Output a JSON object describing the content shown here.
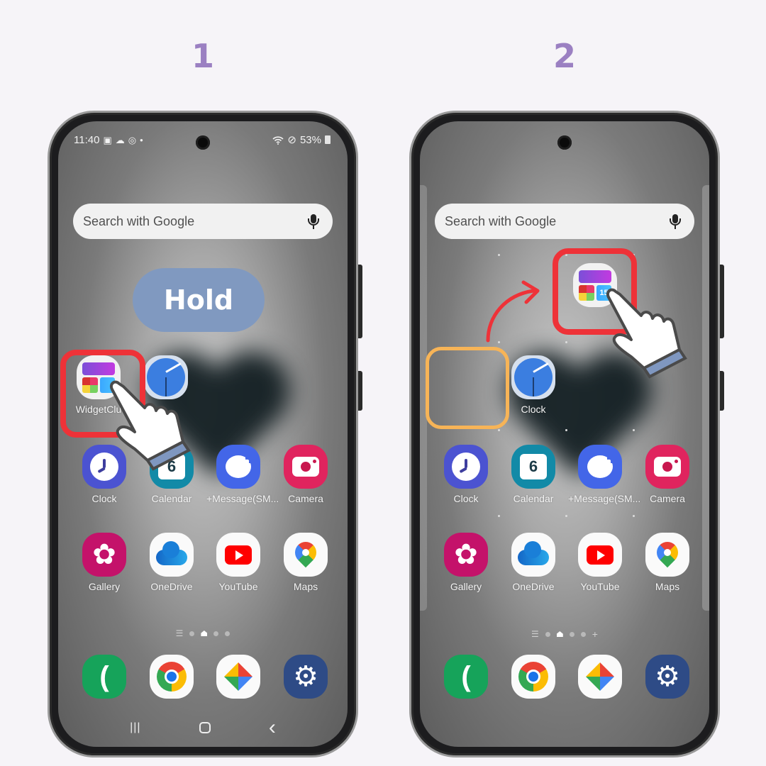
{
  "steps": [
    {
      "number": "1",
      "statusbar": {
        "time": "11:40",
        "left_icons": [
          "gallery-notification-icon",
          "weather-icon",
          "sync-icon",
          "dot-icon"
        ],
        "right_icons": [
          "wifi-icon",
          "do-not-disturb-icon"
        ],
        "battery": "53%"
      },
      "search": {
        "placeholder": "Search with Google",
        "mic_icon": "mic-icon"
      },
      "hint": "Hold",
      "highlighted_app": {
        "label": "WidgetClub",
        "visible_label": "WidgetClu"
      },
      "row1": [
        {
          "label": "WidgetClub",
          "icon": "widgetclub-icon"
        },
        {
          "label": "",
          "icon": "google-clock-icon"
        }
      ],
      "row2": [
        {
          "label": "Clock",
          "icon": "clock-icon"
        },
        {
          "label": "Calendar",
          "icon": "calendar-icon",
          "date": "6"
        },
        {
          "label": "+Message(SM...",
          "icon": "message-icon"
        },
        {
          "label": "Camera",
          "icon": "camera-icon"
        }
      ],
      "row3": [
        {
          "label": "Gallery",
          "icon": "gallery-icon"
        },
        {
          "label": "OneDrive",
          "icon": "onedrive-icon"
        },
        {
          "label": "YouTube",
          "icon": "youtube-icon"
        },
        {
          "label": "Maps",
          "icon": "maps-icon"
        }
      ],
      "page_indicator": {
        "pages": 3,
        "current": "home",
        "has_add": false
      },
      "dock": [
        {
          "icon": "phone-icon"
        },
        {
          "icon": "chrome-icon"
        },
        {
          "icon": "photos-icon"
        },
        {
          "icon": "settings-icon"
        }
      ],
      "navbar": {
        "recents": "|||",
        "back": "‹"
      }
    },
    {
      "number": "2",
      "search": {
        "placeholder": "Search with Google",
        "mic_icon": "mic-icon"
      },
      "dragged_widget_date": "15",
      "row1": [
        {
          "label": "",
          "icon": "empty-slot"
        },
        {
          "label": "Clock",
          "icon": "google-clock-icon"
        }
      ],
      "row2": [
        {
          "label": "Clock",
          "icon": "clock-icon"
        },
        {
          "label": "Calendar",
          "icon": "calendar-icon",
          "date": "6"
        },
        {
          "label": "+Message(SM...",
          "icon": "message-icon"
        },
        {
          "label": "Camera",
          "icon": "camera-icon"
        }
      ],
      "row3": [
        {
          "label": "Gallery",
          "icon": "gallery-icon"
        },
        {
          "label": "OneDrive",
          "icon": "onedrive-icon"
        },
        {
          "label": "YouTube",
          "icon": "youtube-icon"
        },
        {
          "label": "Maps",
          "icon": "maps-icon"
        }
      ],
      "page_indicator": {
        "pages": 3,
        "current": "home",
        "has_add": true
      },
      "dock": [
        {
          "icon": "phone-icon"
        },
        {
          "icon": "chrome-icon"
        },
        {
          "icon": "photos-icon"
        },
        {
          "icon": "settings-icon"
        }
      ]
    }
  ],
  "colors": {
    "step_number": "#9b80c2",
    "highlight_red": "#ee3238",
    "highlight_orange": "#f7b457",
    "hold_pill": "#8099c0"
  },
  "glyphs": {
    "gallery": "✿",
    "phone": "(",
    "settings": "⚙",
    "menu_lines": "☰",
    "plus": "+",
    "wifi": "📶",
    "dnd": "⊘",
    "image": "▣",
    "cloud": "☁",
    "sync": "◎",
    "dot": "•"
  }
}
